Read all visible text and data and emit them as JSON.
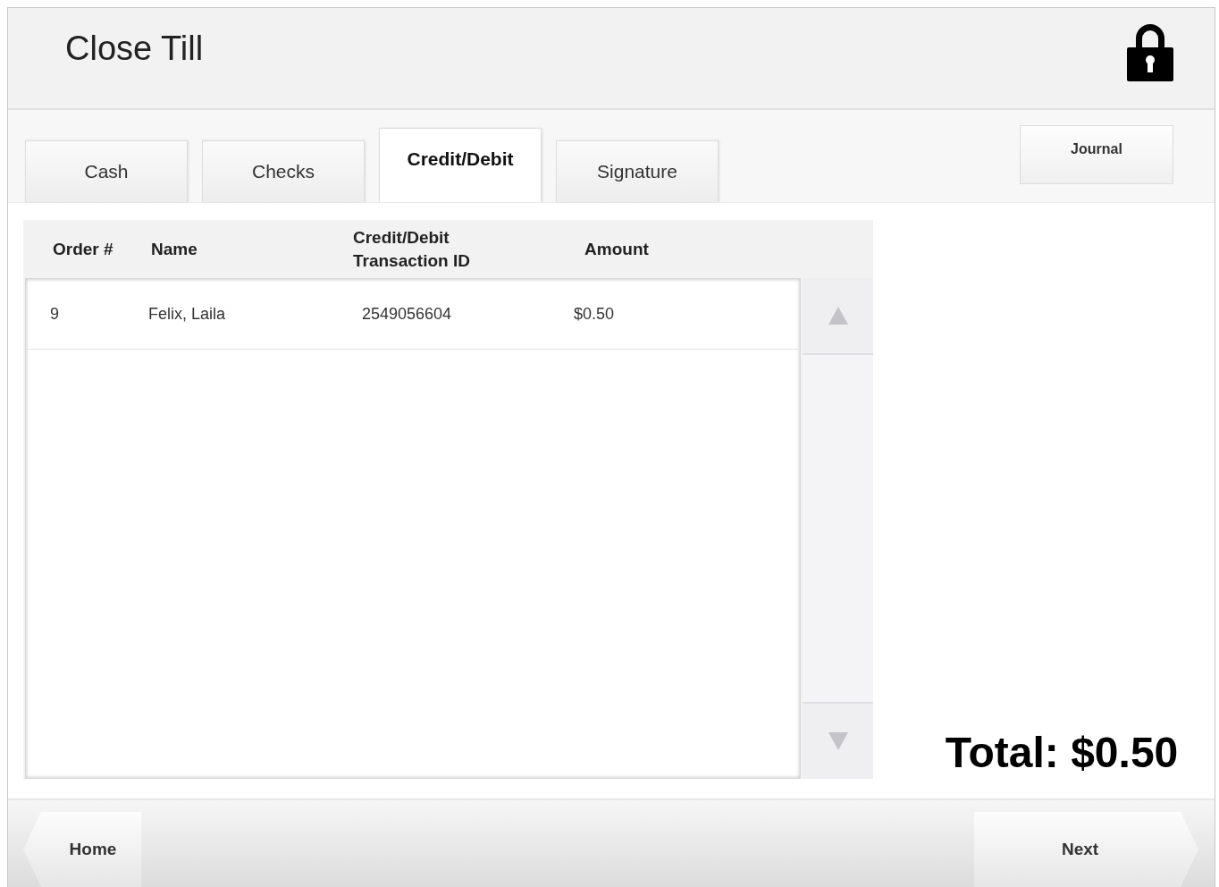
{
  "window": {
    "title": "Close Till"
  },
  "tabs": [
    {
      "label": "Cash",
      "selected": false
    },
    {
      "label": "Checks",
      "selected": false
    },
    {
      "label": "Credit/Debit",
      "selected": true
    },
    {
      "label": "Signature",
      "selected": false
    }
  ],
  "journal_button": "Journal",
  "table": {
    "columns": [
      "Order #",
      "Name",
      "Credit/Debit\nTransaction ID",
      "Amount"
    ],
    "rows": [
      [
        "9",
        "Felix, Laila",
        "2549056604",
        "$0.50"
      ]
    ]
  },
  "total": "Total: $0.50",
  "footer": {
    "home_button": "Home",
    "next_button": "Next"
  }
}
